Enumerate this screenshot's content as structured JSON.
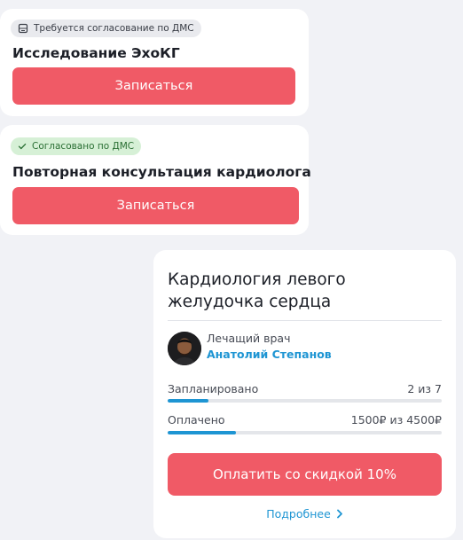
{
  "appointments": [
    {
      "badge_icon": "document-icon",
      "badge_text": "Требуется согласование по ДМС",
      "badge_color": "#e9eaee",
      "title": "Исследование ЭхоКГ",
      "button_label": "Записаться"
    },
    {
      "badge_icon": "check-icon",
      "badge_text": "Согласовано по ДМС",
      "badge_color": "#d6f0d6",
      "title": "Повторная консультация кардиолога",
      "button_label": "Записаться"
    }
  ],
  "program": {
    "title": "Кардиология левого желудочка сердца",
    "doctor_role": "Лечащий врач",
    "doctor_name": "Анатолий Степанов",
    "planned_label": "Запланировано",
    "planned_value": "2 из 7",
    "planned_progress": 0.15,
    "paid_label": "Оплачено",
    "paid_value": "1500₽ из 4500₽",
    "paid_progress": 0.25,
    "pay_button_label": "Оплатить со скидкой 10%",
    "more_link_label": "Подробнее"
  },
  "colors": {
    "accent": "#f05a66",
    "link": "#1e95d3",
    "background": "#f1f2f6"
  }
}
